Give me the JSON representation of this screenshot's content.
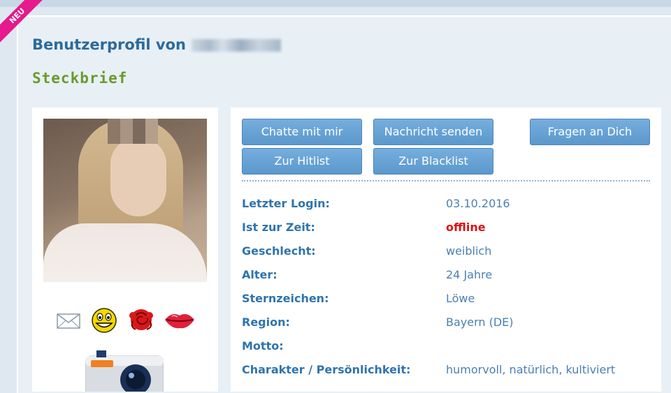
{
  "ribbon": {
    "label": "NEU",
    "color": "#e51a8c"
  },
  "header": {
    "title": "Benutzerprofil von",
    "username_blurred": true
  },
  "section": {
    "subtitle": "Steckbrief"
  },
  "profile_photo": {
    "pixelated_face": true
  },
  "action_icons": [
    "envelope-icon",
    "smiley-icon",
    "rose-icon",
    "lips-icon"
  ],
  "buttons": {
    "chat": "Chatte mit mir",
    "message": "Nachricht senden",
    "questions": "Fragen an Dich",
    "hitlist": "Zur Hitlist",
    "blacklist": "Zur Blacklist"
  },
  "info": [
    {
      "label": "Letzter Login:",
      "value": "03.10.2016"
    },
    {
      "label": "Ist zur Zeit:",
      "value": "offline",
      "status": "offline"
    },
    {
      "label": "Geschlecht:",
      "value": "weiblich"
    },
    {
      "label": "Alter:",
      "value": "24 Jahre"
    },
    {
      "label": "Sternzeichen:",
      "value": "Löwe"
    },
    {
      "label": "Region:",
      "value": "Bayern (DE)"
    },
    {
      "label": "Motto:",
      "value": ""
    },
    {
      "label": "Charakter / Persönlichkeit:",
      "value": "humorvoll, natürlich, kultiviert"
    }
  ],
  "colors": {
    "accent_blue": "#2f74ad",
    "value_blue": "#4a80b3",
    "button_blue": "#5c98cc",
    "subtitle_green": "#6a9a2c",
    "offline_red": "#e01010"
  }
}
